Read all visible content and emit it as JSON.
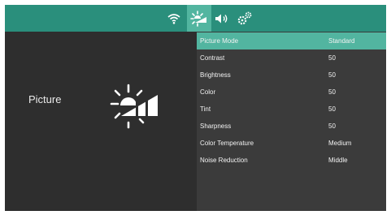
{
  "topbar": {
    "icons": [
      "wifi-icon",
      "picture-icon",
      "sound-icon",
      "settings-icon"
    ],
    "active": "picture-icon"
  },
  "section": {
    "title": "Picture",
    "icon": "brightness-icon"
  },
  "menu": [
    {
      "label": "Picture Mode",
      "value": "Standard",
      "selected": true
    },
    {
      "label": "Contrast",
      "value": "50"
    },
    {
      "label": "Brightness",
      "value": "50"
    },
    {
      "label": "Color",
      "value": "50"
    },
    {
      "label": "Tint",
      "value": "50"
    },
    {
      "label": "Sharpness",
      "value": "50"
    },
    {
      "label": "Color Temperature",
      "value": "Medium"
    },
    {
      "label": "Noise Reduction",
      "value": "Middle"
    }
  ],
  "colors": {
    "accent": "#2a8f7c",
    "highlight": "#52b5a0",
    "panel_dark": "#2e2e2e",
    "panel": "#3b3b3b"
  }
}
